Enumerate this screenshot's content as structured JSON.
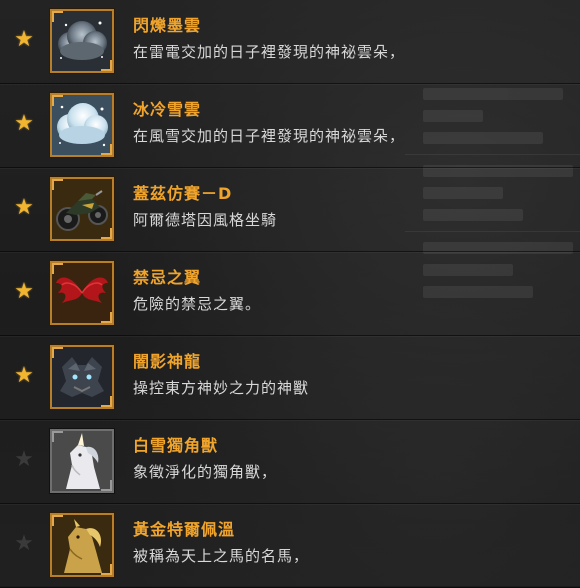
{
  "items": [
    {
      "name": "閃爍墨雲",
      "description": "在雷電交加的日子裡發現的神祕雲朵，",
      "favorited": true,
      "icon": "dark-cloud-icon"
    },
    {
      "name": "冰冷雪雲",
      "description": "在風雪交加的日子裡發現的神祕雲朵，",
      "favorited": true,
      "icon": "snow-cloud-icon"
    },
    {
      "name": "蓋茲仿賽－D",
      "description": "阿爾德塔因風格坐騎",
      "favorited": true,
      "icon": "motorcycle-icon"
    },
    {
      "name": "禁忌之翼",
      "description": "危險的禁忌之翼。",
      "favorited": true,
      "icon": "red-wings-icon"
    },
    {
      "name": "闇影神龍",
      "description": "操控東方神妙之力的神獸",
      "favorited": true,
      "icon": "shadow-dragon-icon"
    },
    {
      "name": "白雪獨角獸",
      "description": "象徵淨化的獨角獸，",
      "favorited": false,
      "icon": "white-unicorn-icon"
    },
    {
      "name": "黃金特爾佩溫",
      "description": "被稱為天上之馬的名馬，",
      "favorited": false,
      "icon": "golden-horse-icon"
    }
  ],
  "colors": {
    "name_text": "#f0a42c",
    "description_text": "#d8d8d8",
    "star_active": "#f2b530",
    "star_inactive": "#3a3a3a",
    "frame_gold": "#b77f2a"
  }
}
